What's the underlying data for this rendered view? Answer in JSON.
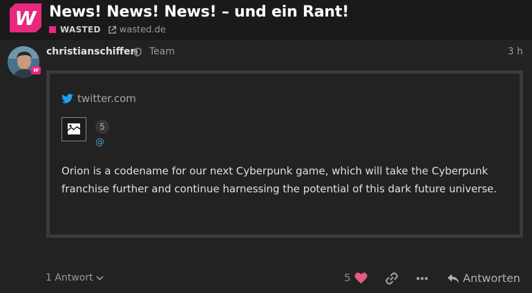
{
  "topic": {
    "title": "News! News! News! – und ein Rant!",
    "category": "WASTED",
    "category_color": "#e6297c",
    "site": "wasted.de"
  },
  "post": {
    "username": "christianschiffer",
    "group": "Team",
    "time": "3 h",
    "onebox": {
      "source": "twitter.com",
      "count": "5",
      "handle": "@",
      "text": "Orion is a codename for our next Cyberpunk game, which will take the Cyberpunk franchise further and continue harnessing the potential of this dark future universe."
    },
    "actions": {
      "replies": "1 Antwort",
      "likes": "5",
      "reply_label": "Antworten"
    }
  },
  "icons": {
    "logo": "wasted-logo",
    "external": "external-link-icon",
    "shield": "shield-icon",
    "twitter": "twitter-icon",
    "heart": "heart-icon",
    "link": "link-icon",
    "more": "more-icon",
    "reply": "reply-icon"
  }
}
